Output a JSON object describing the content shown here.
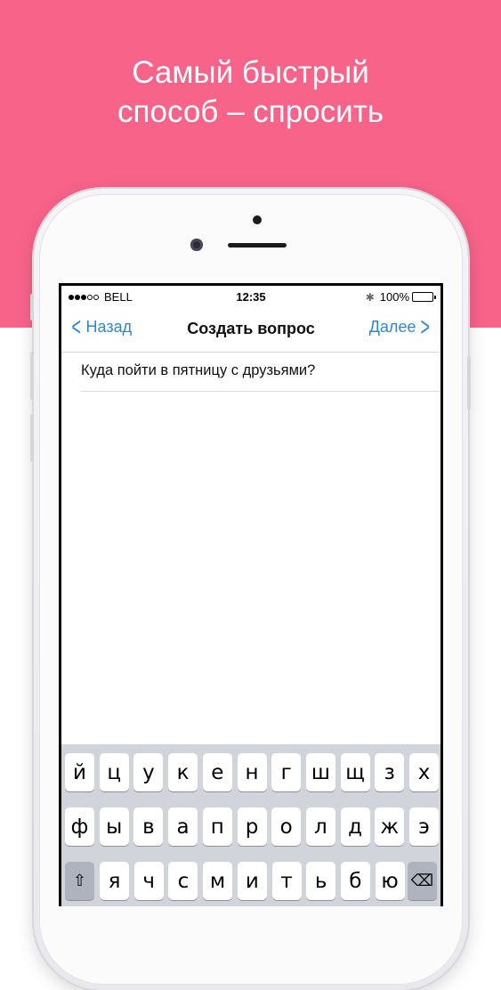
{
  "headline": {
    "line1": "Самый быстрый",
    "line2": "способ – спросить"
  },
  "status_bar": {
    "carrier": "BELL",
    "time": "12:35",
    "battery_text": "100%",
    "battery_level": 1.0,
    "signal_bars_filled": 3,
    "signal_bars_total": 5,
    "bluetooth_icon": "bluetooth-icon"
  },
  "nav": {
    "back_label": "Назад",
    "title": "Создать вопрос",
    "next_label": "Далее"
  },
  "question": {
    "text": "Куда пойти в пятницу с друзьями?"
  },
  "keyboard": {
    "row1": [
      "й",
      "ц",
      "у",
      "к",
      "е",
      "н",
      "г",
      "ш",
      "щ",
      "з",
      "х"
    ],
    "row2": [
      "ф",
      "ы",
      "в",
      "а",
      "п",
      "р",
      "о",
      "л",
      "д",
      "ж",
      "э"
    ],
    "row3": [
      "я",
      "ч",
      "с",
      "м",
      "и",
      "т",
      "ь",
      "б",
      "ю"
    ],
    "shift_icon": "⇧",
    "backspace_icon": "⌫"
  },
  "colors": {
    "banner": "#f8638a",
    "accent": "#2f86d6",
    "keyboard_bg": "#d1d4da"
  }
}
